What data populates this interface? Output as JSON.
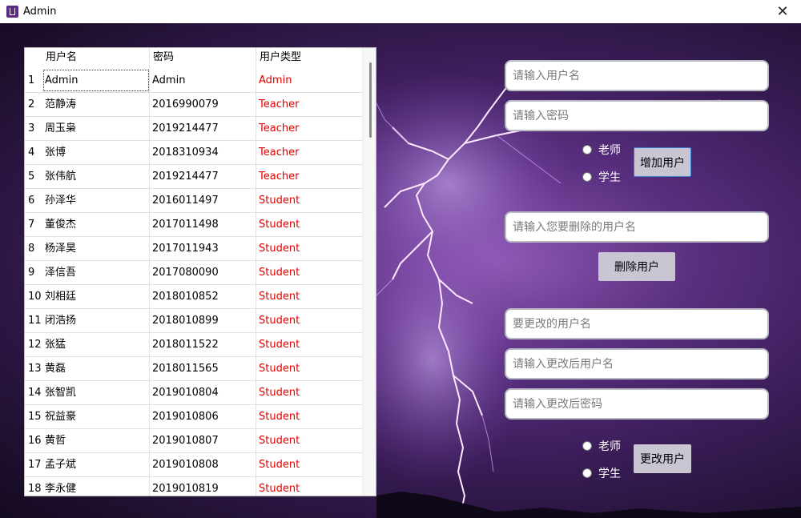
{
  "window": {
    "title": "Admin",
    "close_glyph": "✕"
  },
  "table": {
    "headers": [
      "用户名",
      "密码",
      "用户类型"
    ],
    "rows": [
      [
        "1",
        "Admin",
        "Admin",
        "Admin"
      ],
      [
        "2",
        "范静涛",
        "2016990079",
        "Teacher"
      ],
      [
        "3",
        "周玉枭",
        "2019214477",
        "Teacher"
      ],
      [
        "4",
        "张博",
        "2018310934",
        "Teacher"
      ],
      [
        "5",
        "张伟航",
        "2019214477",
        "Teacher"
      ],
      [
        "6",
        "孙泽华",
        "2016011497",
        "Student"
      ],
      [
        "7",
        "董俊杰",
        "2017011498",
        "Student"
      ],
      [
        "8",
        "杨泽昊",
        "2017011943",
        "Student"
      ],
      [
        "9",
        "泽信吾",
        "2017080090",
        "Student"
      ],
      [
        "10",
        "刘相廷",
        "2018010852",
        "Student"
      ],
      [
        "11",
        "闭浩扬",
        "2018010899",
        "Student"
      ],
      [
        "12",
        "张猛",
        "2018011522",
        "Student"
      ],
      [
        "13",
        "黄磊",
        "2018011565",
        "Student"
      ],
      [
        "14",
        "张智凯",
        "2019010804",
        "Student"
      ],
      [
        "15",
        "祝益豪",
        "2019010806",
        "Student"
      ],
      [
        "16",
        "黄哲",
        "2019010807",
        "Student"
      ],
      [
        "17",
        "孟子斌",
        "2019010808",
        "Student"
      ],
      [
        "18",
        "李永健",
        "2019010819",
        "Student"
      ]
    ]
  },
  "add_user": {
    "username_placeholder": "请输入用户名",
    "password_placeholder": "请输入密码",
    "radio_teacher": "老师",
    "radio_student": "学生",
    "button": "增加用户"
  },
  "delete_user": {
    "username_placeholder": "请输入您要删除的用户名",
    "button": "删除用户"
  },
  "modify_user": {
    "target_placeholder": "要更改的用户名",
    "new_username_placeholder": "请输入更改后用户名",
    "new_password_placeholder": "请输入更改后密码",
    "radio_teacher": "老师",
    "radio_student": "学生",
    "button": "更改用户"
  },
  "colors": {
    "user_type_text": "#e00000",
    "button_bg": "#c9c5d2",
    "focus_border": "#3a7bd5"
  }
}
